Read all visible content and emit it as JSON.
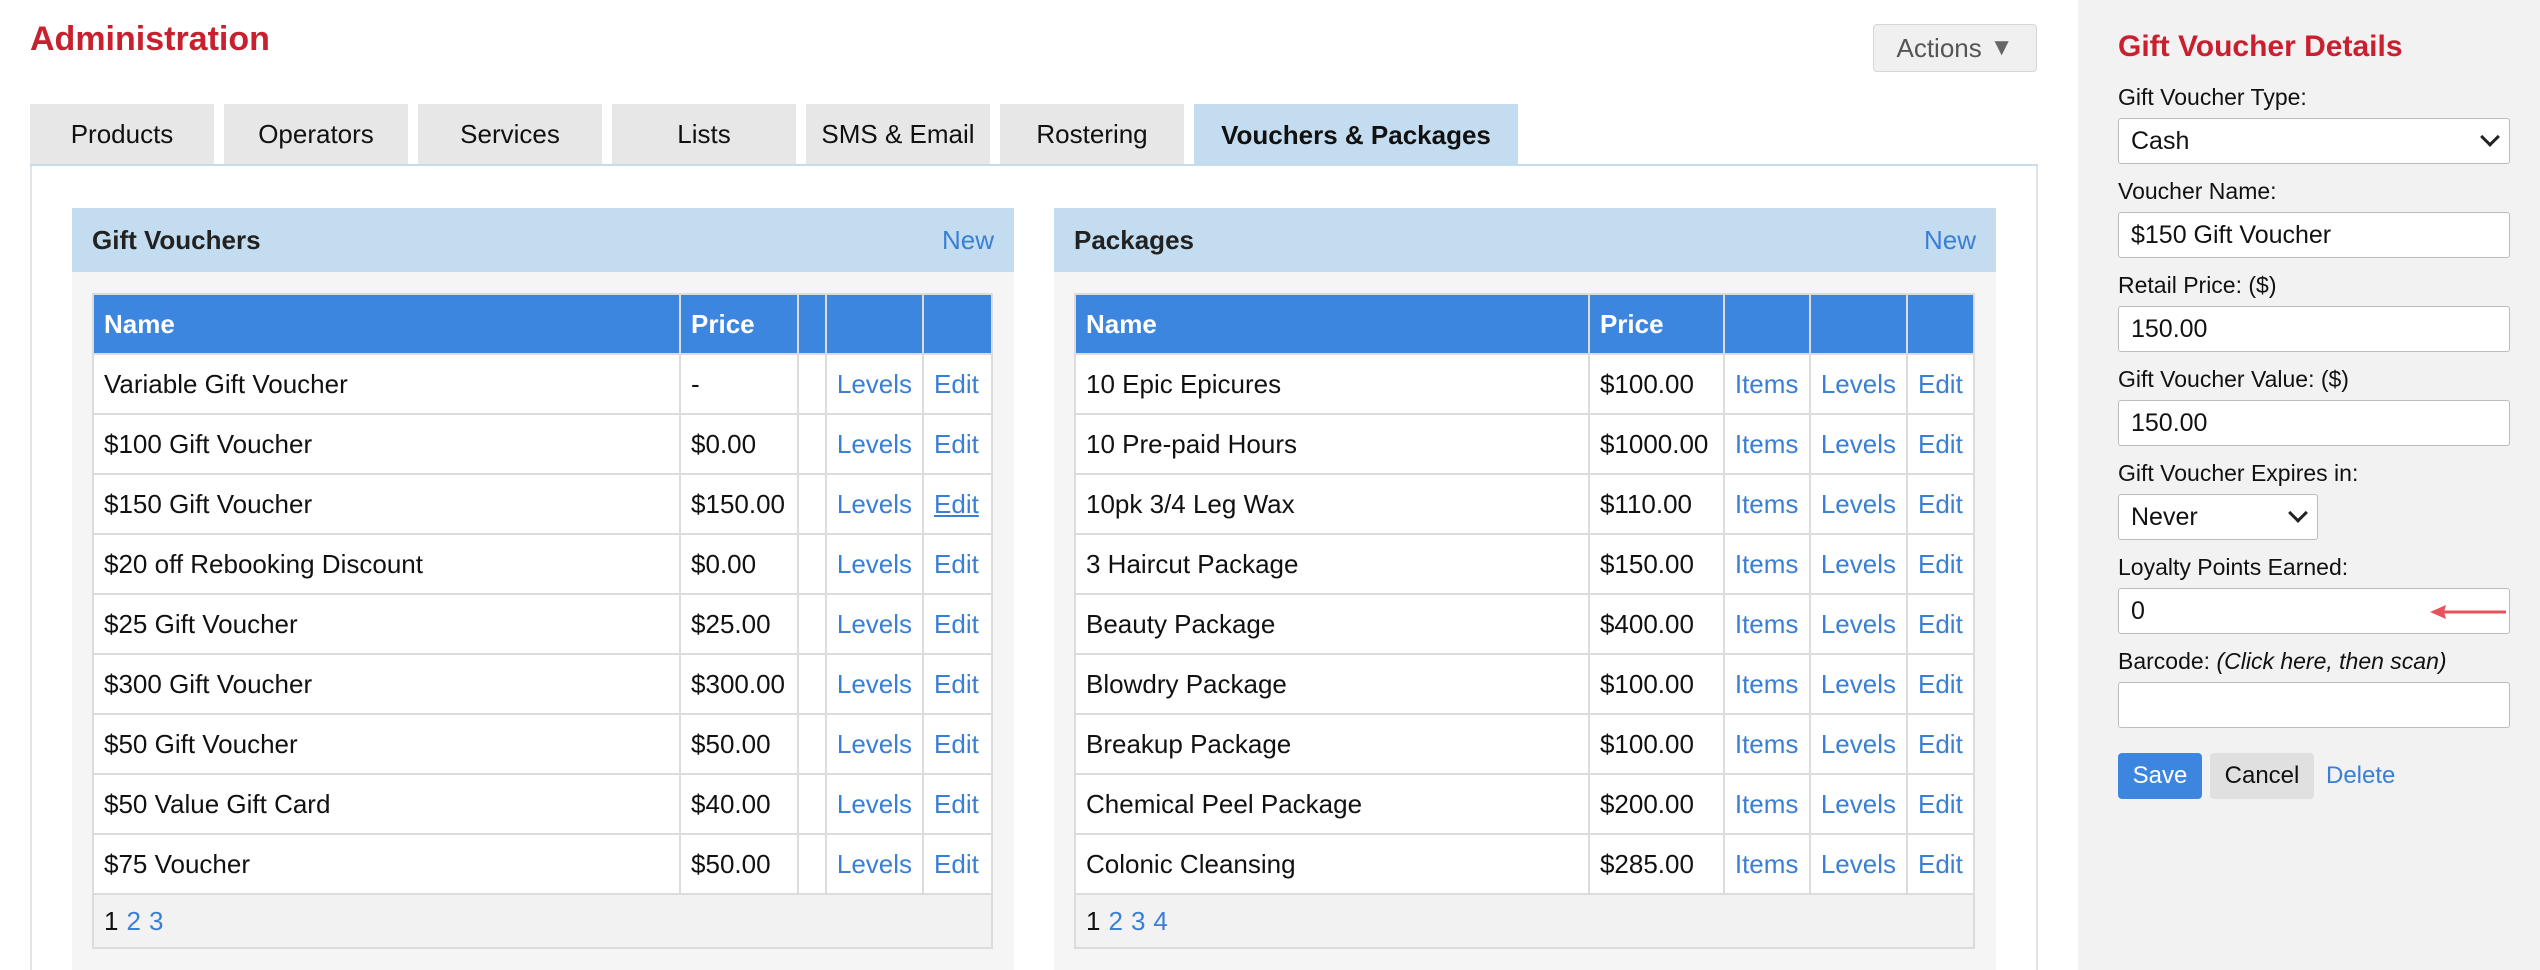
{
  "page": {
    "title": "Administration",
    "actions_label": "Actions",
    "actions_icon": "triangle-down-icon"
  },
  "tabs": [
    {
      "label": "Products"
    },
    {
      "label": "Operators"
    },
    {
      "label": "Services"
    },
    {
      "label": "Lists"
    },
    {
      "label": "SMS & Email"
    },
    {
      "label": "Rostering"
    },
    {
      "label": "Vouchers & Packages",
      "active": true
    }
  ],
  "gift_vouchers": {
    "title": "Gift Vouchers",
    "new_label": "New",
    "columns": [
      "Name",
      "Price",
      "",
      "",
      ""
    ],
    "rows": [
      {
        "name": "Variable Gift Voucher",
        "price": "-",
        "levels": "Levels",
        "edit": "Edit"
      },
      {
        "name": "$100 Gift Voucher",
        "price": "$0.00",
        "levels": "Levels",
        "edit": "Edit"
      },
      {
        "name": "$150 Gift Voucher",
        "price": "$150.00",
        "levels": "Levels",
        "edit": "Edit"
      },
      {
        "name": "$20 off Rebooking Discount",
        "price": "$0.00",
        "levels": "Levels",
        "edit": "Edit"
      },
      {
        "name": "$25 Gift Voucher",
        "price": "$25.00",
        "levels": "Levels",
        "edit": "Edit"
      },
      {
        "name": "$300 Gift Voucher",
        "price": "$300.00",
        "levels": "Levels",
        "edit": "Edit"
      },
      {
        "name": "$50 Gift Voucher",
        "price": "$50.00",
        "levels": "Levels",
        "edit": "Edit"
      },
      {
        "name": "$50 Value Gift Card",
        "price": "$40.00",
        "levels": "Levels",
        "edit": "Edit"
      },
      {
        "name": "$75 Voucher",
        "price": "$50.00",
        "levels": "Levels",
        "edit": "Edit"
      }
    ],
    "pages": [
      "1",
      "2",
      "3"
    ]
  },
  "packages": {
    "title": "Packages",
    "new_label": "New",
    "columns": [
      "Name",
      "Price",
      "",
      "",
      ""
    ],
    "rows": [
      {
        "name": "10 Epic Epicures",
        "price": "$100.00",
        "items": "Items",
        "levels": "Levels",
        "edit": "Edit"
      },
      {
        "name": "10 Pre-paid Hours",
        "price": "$1000.00",
        "items": "Items",
        "levels": "Levels",
        "edit": "Edit"
      },
      {
        "name": "10pk 3/4 Leg Wax",
        "price": "$110.00",
        "items": "Items",
        "levels": "Levels",
        "edit": "Edit"
      },
      {
        "name": "3 Haircut Package",
        "price": "$150.00",
        "items": "Items",
        "levels": "Levels",
        "edit": "Edit"
      },
      {
        "name": "Beauty Package",
        "price": "$400.00",
        "items": "Items",
        "levels": "Levels",
        "edit": "Edit"
      },
      {
        "name": "Blowdry Package",
        "price": "$100.00",
        "items": "Items",
        "levels": "Levels",
        "edit": "Edit"
      },
      {
        "name": "Breakup Package",
        "price": "$100.00",
        "items": "Items",
        "levels": "Levels",
        "edit": "Edit"
      },
      {
        "name": "Chemical Peel Package",
        "price": "$200.00",
        "items": "Items",
        "levels": "Levels",
        "edit": "Edit"
      },
      {
        "name": "Colonic Cleansing",
        "price": "$285.00",
        "items": "Items",
        "levels": "Levels",
        "edit": "Edit"
      }
    ],
    "pages": [
      "1",
      "2",
      "3",
      "4"
    ]
  },
  "details": {
    "title": "Gift Voucher Details",
    "type_label": "Gift Voucher Type:",
    "type_value": "Cash",
    "name_label": "Voucher Name:",
    "name_value": "$150 Gift Voucher",
    "retail_label": "Retail Price: ($)",
    "retail_value": "150.00",
    "value_label": "Gift Voucher Value: ($)",
    "value_value": "150.00",
    "expires_label": "Gift Voucher Expires in:",
    "expires_value": "Never",
    "loyalty_label": "Loyalty Points Earned:",
    "loyalty_value": "0",
    "barcode_label": "Barcode:",
    "barcode_hint": "(Click here, then scan)",
    "barcode_value": "",
    "save_label": "Save",
    "cancel_label": "Cancel",
    "delete_label": "Delete"
  },
  "colors": {
    "title_red": "#c8202f",
    "header_blue": "#3d86e0",
    "section_blue": "#c3dcef",
    "link_blue": "#3a7fd5",
    "annotation_arrow": "#e8525a"
  }
}
